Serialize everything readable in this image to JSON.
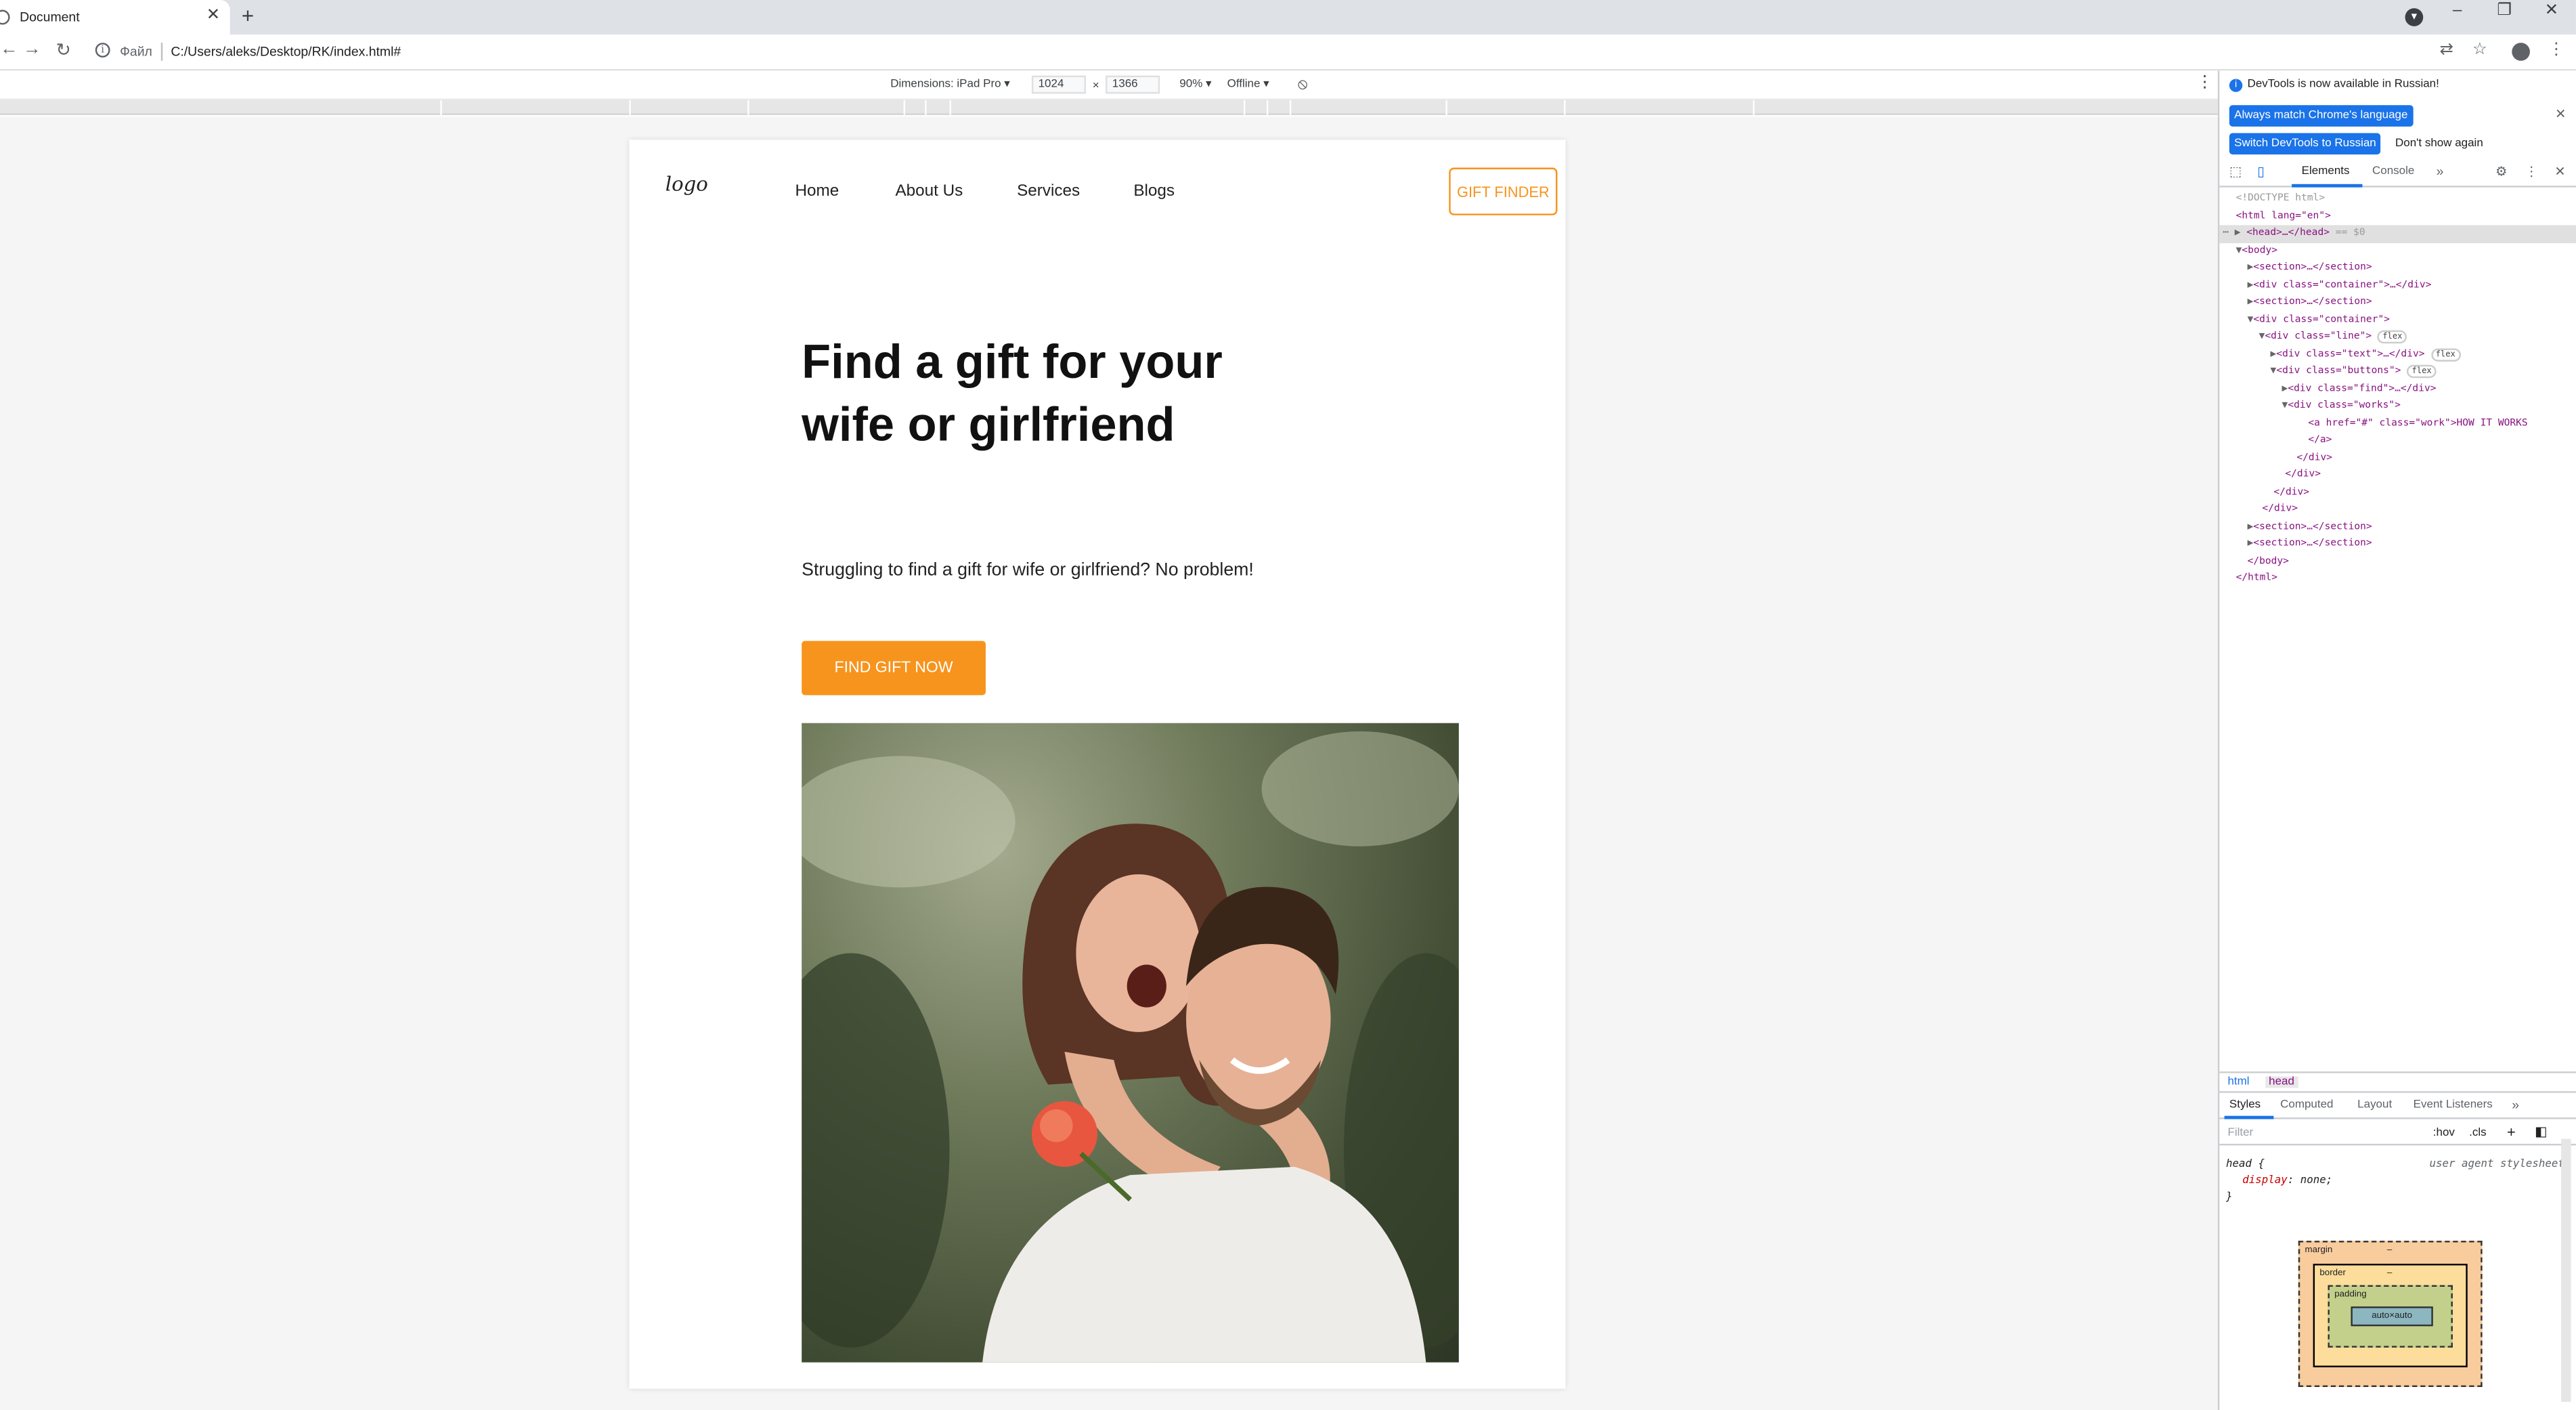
{
  "browser": {
    "tab_title": "Document",
    "new_tab_symbol": "+",
    "address_file_label": "Файл",
    "address_url": "C:/Users/aleks/Desktop/RK/index.html#"
  },
  "device_toolbar": {
    "dimensions_label": "Dimensions: iPad Pro",
    "width": "1024",
    "height": "1366",
    "times": "×",
    "zoom": "90%",
    "network": "Offline"
  },
  "site": {
    "logo": "logo",
    "nav": [
      "Home",
      "About Us",
      "Services",
      "Blogs"
    ],
    "gift_finder": "GIFT FINDER",
    "hero_title": "Find a gift for your wife or girlfriend",
    "hero_subtitle": "Struggling to find a gift for wife or girlfriend? No problem!",
    "cta": "FIND GIFT NOW"
  },
  "devtools": {
    "banner_text": "DevTools is now available in Russian!",
    "btn_match": "Always match Chrome's language",
    "btn_switch": "Switch DevTools to Russian",
    "btn_dont_show": "Don't show again",
    "tabs": [
      "Elements",
      "Console"
    ],
    "dom": {
      "doctype": "<!DOCTYPE html>",
      "html_open": "<html lang=\"en\">",
      "head": "<head>…</head>",
      "head_suffix": "== $0",
      "body_open": "<body>",
      "section_collapsed": "<section>…</section>",
      "div_container_collapsed": "<div class=\"container\">…</div>",
      "div_container_open": "<div class=\"container\">",
      "div_line_open": "<div class=\"line\">",
      "div_text_collapsed": "<div class=\"text\">…</div>",
      "div_buttons_open": "<div class=\"buttons\">",
      "div_find_collapsed": "<div class=\"find\">…</div>",
      "div_works_open": "<div class=\"works\">",
      "a_work": "<a href=\"#\" class=\"work\">HOW IT WORKS",
      "a_close": "</a>",
      "div_close": "</div>",
      "body_close": "</body>",
      "html_close": "</html>",
      "flex_badge": "flex"
    },
    "breadcrumbs": [
      "html",
      "head"
    ],
    "style_tabs": [
      "Styles",
      "Computed",
      "Layout",
      "Event Listeners"
    ],
    "filter_placeholder": "Filter",
    "filter_hov": ":hov",
    "filter_cls": ".cls",
    "rule_selector": "head {",
    "rule_source": "user agent stylesheet",
    "rule_decl_prop": "display",
    "rule_decl_val": "none;",
    "rule_close": "}",
    "box_model": {
      "margin": "margin",
      "border": "border",
      "padding": "padding",
      "content": "auto×auto",
      "dash": "–"
    }
  },
  "colors": {
    "accent": "#f7941d",
    "devtools_blue": "#1a73e8"
  },
  "icons": [
    "back-icon",
    "forward-icon",
    "reload-icon",
    "info-icon",
    "translate-icon",
    "star-icon",
    "profile-icon",
    "menu-icon",
    "inspect-icon",
    "device-icon",
    "settings-icon",
    "close-icon"
  ]
}
